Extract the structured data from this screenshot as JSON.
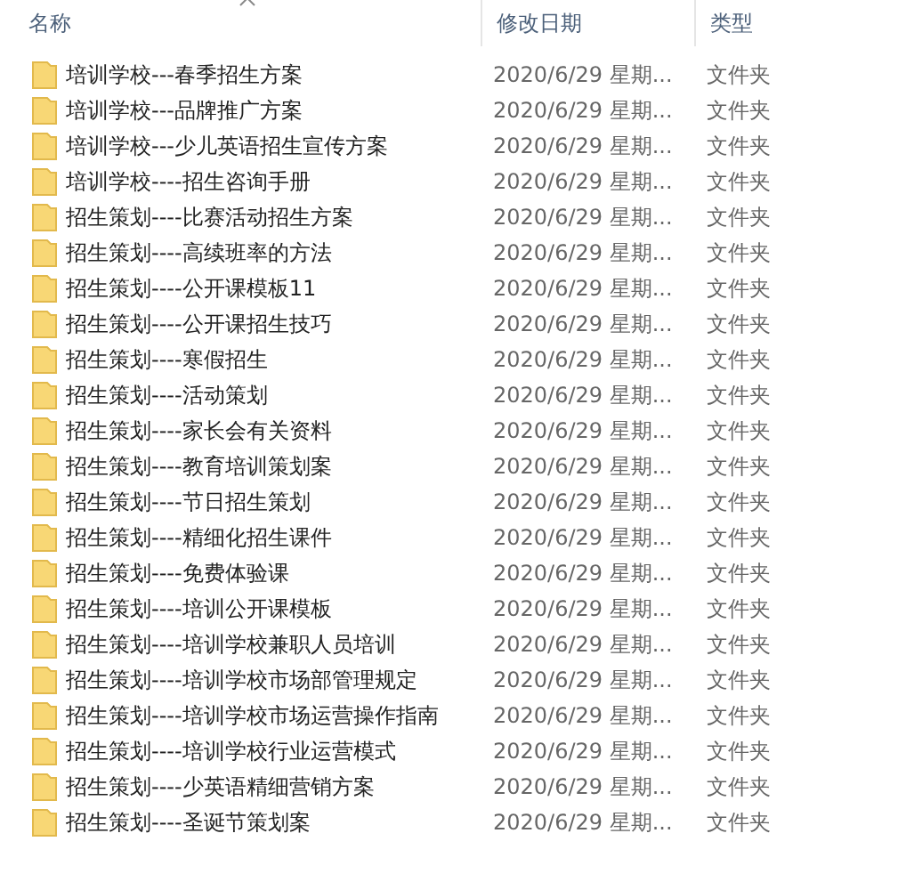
{
  "columns": [
    {
      "label": "名称",
      "sorted": true
    },
    {
      "label": "修改日期",
      "sorted": false
    },
    {
      "label": "类型",
      "sorted": false
    }
  ],
  "rows": [
    {
      "name": "培训学校---春季招生方案",
      "date": "2020/6/29 星期...",
      "type": "文件夹"
    },
    {
      "name": "培训学校---品牌推广方案",
      "date": "2020/6/29 星期...",
      "type": "文件夹"
    },
    {
      "name": "培训学校---少儿英语招生宣传方案",
      "date": "2020/6/29 星期...",
      "type": "文件夹"
    },
    {
      "name": "培训学校----招生咨询手册",
      "date": "2020/6/29 星期...",
      "type": "文件夹"
    },
    {
      "name": "招生策划----比赛活动招生方案",
      "date": "2020/6/29 星期...",
      "type": "文件夹"
    },
    {
      "name": "招生策划----高续班率的方法",
      "date": "2020/6/29 星期...",
      "type": "文件夹"
    },
    {
      "name": "招生策划----公开课模板11",
      "date": "2020/6/29 星期...",
      "type": "文件夹"
    },
    {
      "name": "招生策划----公开课招生技巧",
      "date": "2020/6/29 星期...",
      "type": "文件夹"
    },
    {
      "name": "招生策划----寒假招生",
      "date": "2020/6/29 星期...",
      "type": "文件夹"
    },
    {
      "name": "招生策划----活动策划",
      "date": "2020/6/29 星期...",
      "type": "文件夹"
    },
    {
      "name": "招生策划----家长会有关资料",
      "date": "2020/6/29 星期...",
      "type": "文件夹"
    },
    {
      "name": "招生策划----教育培训策划案",
      "date": "2020/6/29 星期...",
      "type": "文件夹"
    },
    {
      "name": "招生策划----节日招生策划",
      "date": "2020/6/29 星期...",
      "type": "文件夹"
    },
    {
      "name": "招生策划----精细化招生课件",
      "date": "2020/6/29 星期...",
      "type": "文件夹"
    },
    {
      "name": "招生策划----免费体验课",
      "date": "2020/6/29 星期...",
      "type": "文件夹"
    },
    {
      "name": "招生策划----培训公开课模板",
      "date": "2020/6/29 星期...",
      "type": "文件夹"
    },
    {
      "name": "招生策划----培训学校兼职人员培训",
      "date": "2020/6/29 星期...",
      "type": "文件夹"
    },
    {
      "name": "招生策划----培训学校市场部管理规定",
      "date": "2020/6/29 星期...",
      "type": "文件夹"
    },
    {
      "name": "招生策划----培训学校市场运营操作指南",
      "date": "2020/6/29 星期...",
      "type": "文件夹"
    },
    {
      "name": "招生策划----培训学校行业运营模式",
      "date": "2020/6/29 星期...",
      "type": "文件夹"
    },
    {
      "name": "招生策划----少英语精细营销方案",
      "date": "2020/6/29 星期...",
      "type": "文件夹"
    },
    {
      "name": "招生策划----圣诞节策划案",
      "date": "2020/6/29 星期...",
      "type": "文件夹"
    }
  ]
}
